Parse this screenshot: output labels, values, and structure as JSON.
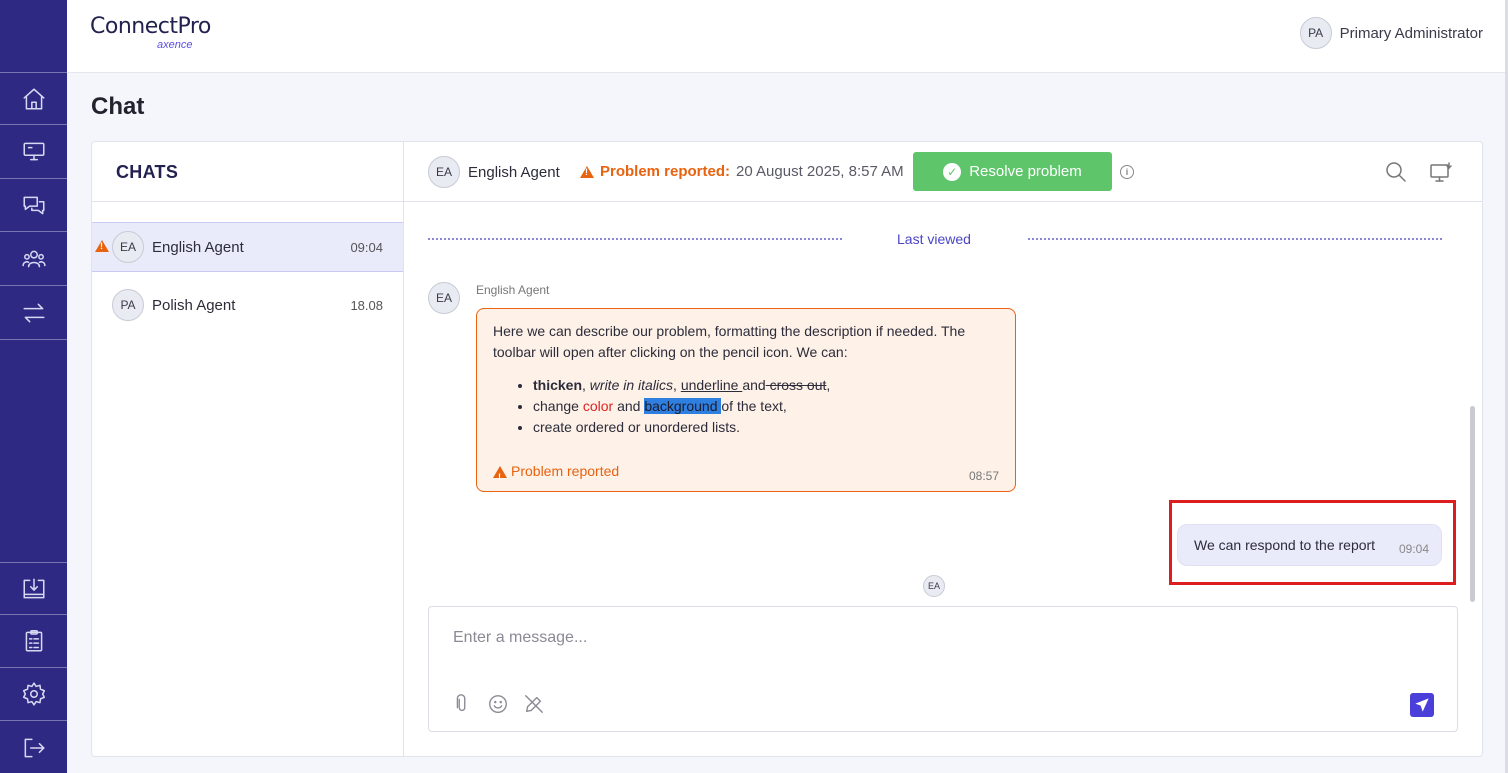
{
  "app": {
    "logo_text": "ConnectPro",
    "logo_sub": "axence"
  },
  "header": {
    "user_initials": "PA",
    "user_name": "Primary Administrator"
  },
  "sidebar": {
    "items": [
      {
        "icon": "home-icon"
      },
      {
        "icon": "devices-icon"
      },
      {
        "icon": "chat-icon"
      },
      {
        "icon": "users-icon"
      },
      {
        "icon": "transfer-icon"
      },
      {
        "icon": "download-icon"
      },
      {
        "icon": "clipboard-icon"
      },
      {
        "icon": "settings-icon"
      },
      {
        "icon": "logout-icon"
      }
    ]
  },
  "page": {
    "title": "Chat"
  },
  "chats": {
    "heading": "CHATS",
    "items": [
      {
        "initials": "EA",
        "name": "English Agent",
        "time": "09:04",
        "warning": true
      },
      {
        "initials": "PA",
        "name": "Polish Agent",
        "time": "18.08",
        "warning": false
      }
    ]
  },
  "conversation": {
    "agent_initials": "EA",
    "agent_name": "English Agent",
    "problem_label": "Problem reported:",
    "problem_date": "20 August 2025, 8:57 AM",
    "resolve_label": "Resolve problem",
    "last_viewed": "Last viewed",
    "message": {
      "sender_initials": "EA",
      "sender": "English Agent",
      "intro": "Here we can describe our problem, formatting the description if needed. The toolbar will open after clicking on the pencil icon. We can:",
      "bullet1_bold": "thicken",
      "bullet1_italic": "write in italics",
      "bullet1_underline": "underline ",
      "bullet1_and": "and",
      "bullet1_strike": " cross out",
      "bullet2_a": "change ",
      "bullet2_color": "color",
      "bullet2_b": " and ",
      "bullet2_bg": "background ",
      "bullet2_c": "of the text,",
      "bullet3": "create ordered or unordered lists.",
      "footer": "Problem reported",
      "time": "08:57"
    },
    "reply": {
      "text": "We can respond to the report",
      "time": "09:04"
    },
    "seen_initials": "EA",
    "composer_placeholder": "Enter a message..."
  },
  "colors": {
    "sidebar": "#2e2a84",
    "accent": "#4a3fd9",
    "warning": "#e8620f",
    "success": "#5fc56b",
    "highlight_frame": "#dd1e1e"
  }
}
